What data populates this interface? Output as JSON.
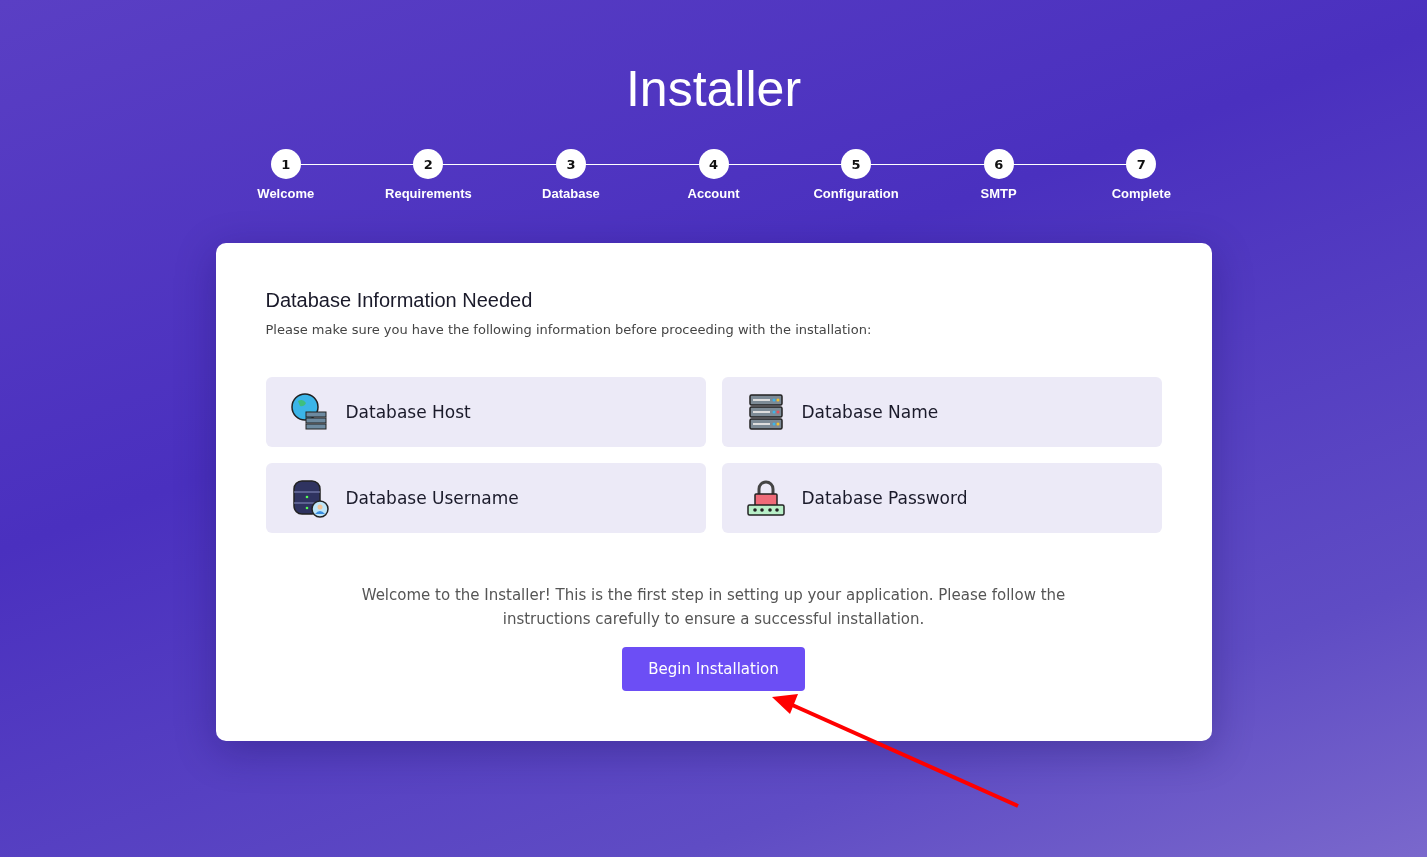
{
  "title": "Installer",
  "steps": [
    {
      "number": "1",
      "label": "Welcome"
    },
    {
      "number": "2",
      "label": "Requirements"
    },
    {
      "number": "3",
      "label": "Database"
    },
    {
      "number": "4",
      "label": "Account"
    },
    {
      "number": "5",
      "label": "Configuration"
    },
    {
      "number": "6",
      "label": "SMTP"
    },
    {
      "number": "7",
      "label": "Complete"
    }
  ],
  "card": {
    "heading": "Database Information Needed",
    "subtitle": "Please make sure you have the following information before proceeding with the installation:",
    "items": [
      {
        "kind": "host",
        "label": "Database Host"
      },
      {
        "kind": "name",
        "label": "Database Name"
      },
      {
        "kind": "username",
        "label": "Database Username"
      },
      {
        "kind": "password",
        "label": "Database Password"
      }
    ],
    "message": "Welcome to the Installer! This is the first step in setting up your application. Please follow the instructions carefully to ensure a successful installation.",
    "button": "Begin Installation"
  }
}
